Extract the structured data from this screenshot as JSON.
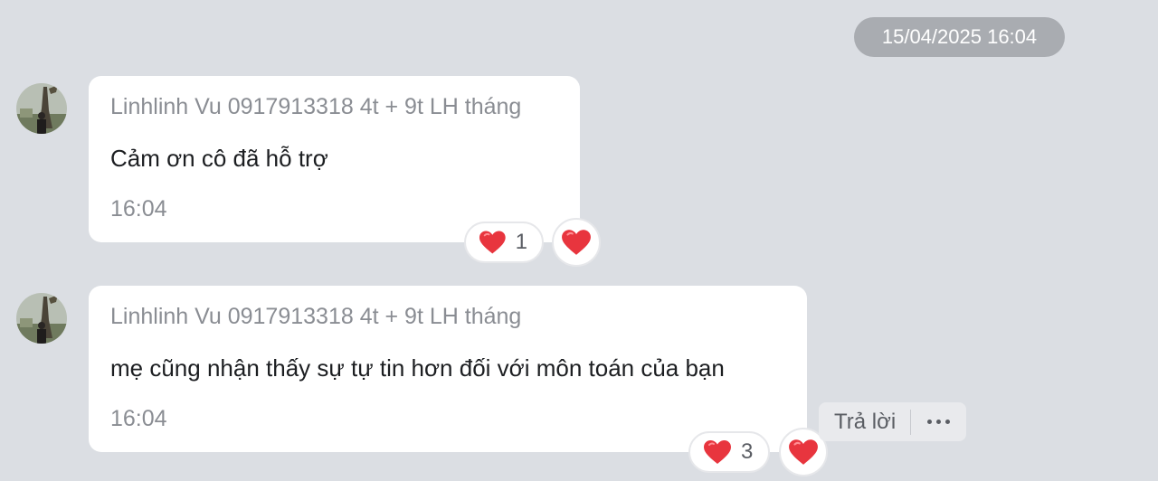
{
  "date_separator": "15/04/2025 16:04",
  "messages": [
    {
      "sender": "Linhlinh Vu 0917913318 4t + 9t LH tháng",
      "text": "Cảm ơn cô đã hỗ trợ",
      "time": "16:04",
      "reaction_icon": "heart-icon",
      "reaction_count": "1"
    },
    {
      "sender": "Linhlinh Vu 0917913318 4t + 9t LH tháng",
      "text": "mẹ cũng nhận thấy sự tự tin hơn đối với môn toán của bạn",
      "time": "16:04",
      "reaction_icon": "heart-icon",
      "reaction_count": "3"
    }
  ],
  "actions": {
    "reply_label": "Trả lời",
    "more_icon": "more-dots-icon"
  },
  "colors": {
    "background": "#dbdee3",
    "bubble": "#ffffff",
    "heart": "#e8353e",
    "date_pill": "#a9acb1"
  }
}
